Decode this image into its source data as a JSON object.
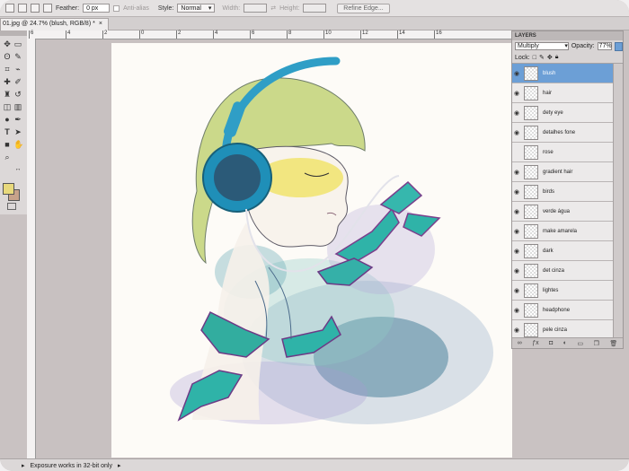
{
  "options_bar": {
    "feather_label": "Feather:",
    "feather_value": "0 px",
    "antialias_label": "Anti-alias",
    "style_label": "Style:",
    "style_value": "Normal",
    "width_label": "Width:",
    "height_label": "Height:",
    "refine_edge_label": "Refine Edge..."
  },
  "document_tab": {
    "title": "01.jpg @ 24.7% (blush, RGB/8) *",
    "close": "×"
  },
  "ruler": {
    "h_numbers": [
      "6",
      "4",
      "2",
      "0",
      "2",
      "4",
      "6",
      "8",
      "10",
      "12",
      "14",
      "16"
    ]
  },
  "tools": {
    "icons": [
      "move-icon",
      "marquee-icon",
      "lasso-icon",
      "quick-select-icon",
      "crop-icon",
      "eyedropper-icon",
      "healing-icon",
      "brush-icon",
      "stamp-icon",
      "history-brush-icon",
      "eraser-icon",
      "gradient-icon",
      "dodge-icon",
      "pen-icon",
      "type-icon",
      "path-select-icon",
      "shape-icon",
      "hand-icon",
      "zoom-icon"
    ],
    "foreground_color": "#e8d97c",
    "background_color": "#c7a28a"
  },
  "layers_panel": {
    "title": "LAYERS",
    "blend_mode": "Multiply",
    "opacity_label": "Opacity:",
    "opacity_value": "77%",
    "lock_label": "Lock:",
    "selected_layer": "blush",
    "layers": [
      {
        "name": "blush",
        "visible": true,
        "selected": true
      },
      {
        "name": "hair",
        "visible": true,
        "selected": false
      },
      {
        "name": "dety eye",
        "visible": true,
        "selected": false
      },
      {
        "name": "detalhes fone",
        "visible": true,
        "selected": false
      },
      {
        "name": "rose",
        "visible": false,
        "selected": false
      },
      {
        "name": "gradient hair",
        "visible": true,
        "selected": false
      },
      {
        "name": "birds",
        "visible": true,
        "selected": false
      },
      {
        "name": "verde água",
        "visible": true,
        "selected": false
      },
      {
        "name": "make amarela",
        "visible": true,
        "selected": false
      },
      {
        "name": "dark",
        "visible": true,
        "selected": false
      },
      {
        "name": "det cinza",
        "visible": true,
        "selected": false
      },
      {
        "name": "lightes",
        "visible": true,
        "selected": false
      },
      {
        "name": "headphone",
        "visible": true,
        "selected": false
      },
      {
        "name": "pele cinza",
        "visible": true,
        "selected": false
      }
    ]
  },
  "status_bar": {
    "message": "Exposure works in 32-bit only"
  }
}
